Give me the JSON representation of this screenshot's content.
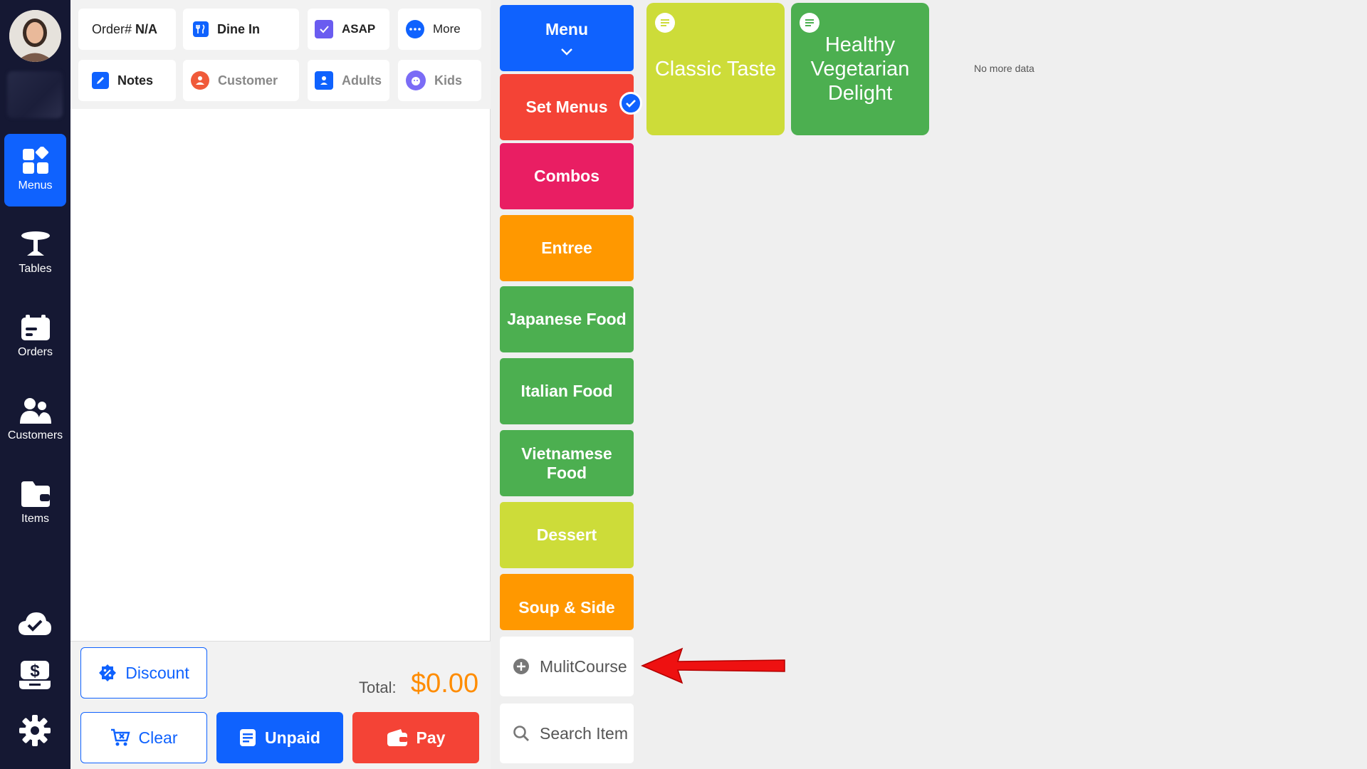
{
  "nav": {
    "items": [
      {
        "label": "Menus",
        "icon": "grid-icon",
        "active": true
      },
      {
        "label": "Tables",
        "icon": "table-icon"
      },
      {
        "label": "Orders",
        "icon": "orders-icon"
      },
      {
        "label": "Customers",
        "icon": "customers-icon"
      },
      {
        "label": "Items",
        "icon": "items-icon"
      }
    ],
    "bottom_icons": [
      "cloud-check-icon",
      "cash-drawer-icon",
      "gear-icon"
    ]
  },
  "order": {
    "order_no_label": "Order#",
    "order_no_value": "N/A",
    "dine_in": "Dine In",
    "asap": "ASAP",
    "more": "More",
    "notes": "Notes",
    "customer": "Customer",
    "adults": "Adults",
    "kids": "Kids"
  },
  "footer": {
    "discount": "Discount",
    "total_label": "Total:",
    "total_value": "$0.00",
    "clear": "Clear",
    "unpaid": "Unpaid",
    "pay": "Pay"
  },
  "categories": [
    {
      "label": "Menu",
      "color": "#0f62fe"
    },
    {
      "label": "Set Menus",
      "color": "#f44336",
      "selected": true
    },
    {
      "label": "Combos",
      "color": "#e91e63"
    },
    {
      "label": "Entree",
      "color": "#ff9800"
    },
    {
      "label": "Japanese Food",
      "color": "#4caf50"
    },
    {
      "label": "Italian Food",
      "color": "#4caf50"
    },
    {
      "label": "Vietnamese Food",
      "color": "#4caf50"
    },
    {
      "label": "Dessert",
      "color": "#cddc39"
    },
    {
      "label": "Soup & Side",
      "color": "#ff9800"
    }
  ],
  "actions": {
    "multicourse": "MulitCourse",
    "search": "Search Item"
  },
  "items": [
    {
      "label": "Classic Taste",
      "color": "#cddc39"
    },
    {
      "label": "Healthy Vegetarian Delight",
      "color": "#4caf50"
    }
  ],
  "no_more": "No more data"
}
